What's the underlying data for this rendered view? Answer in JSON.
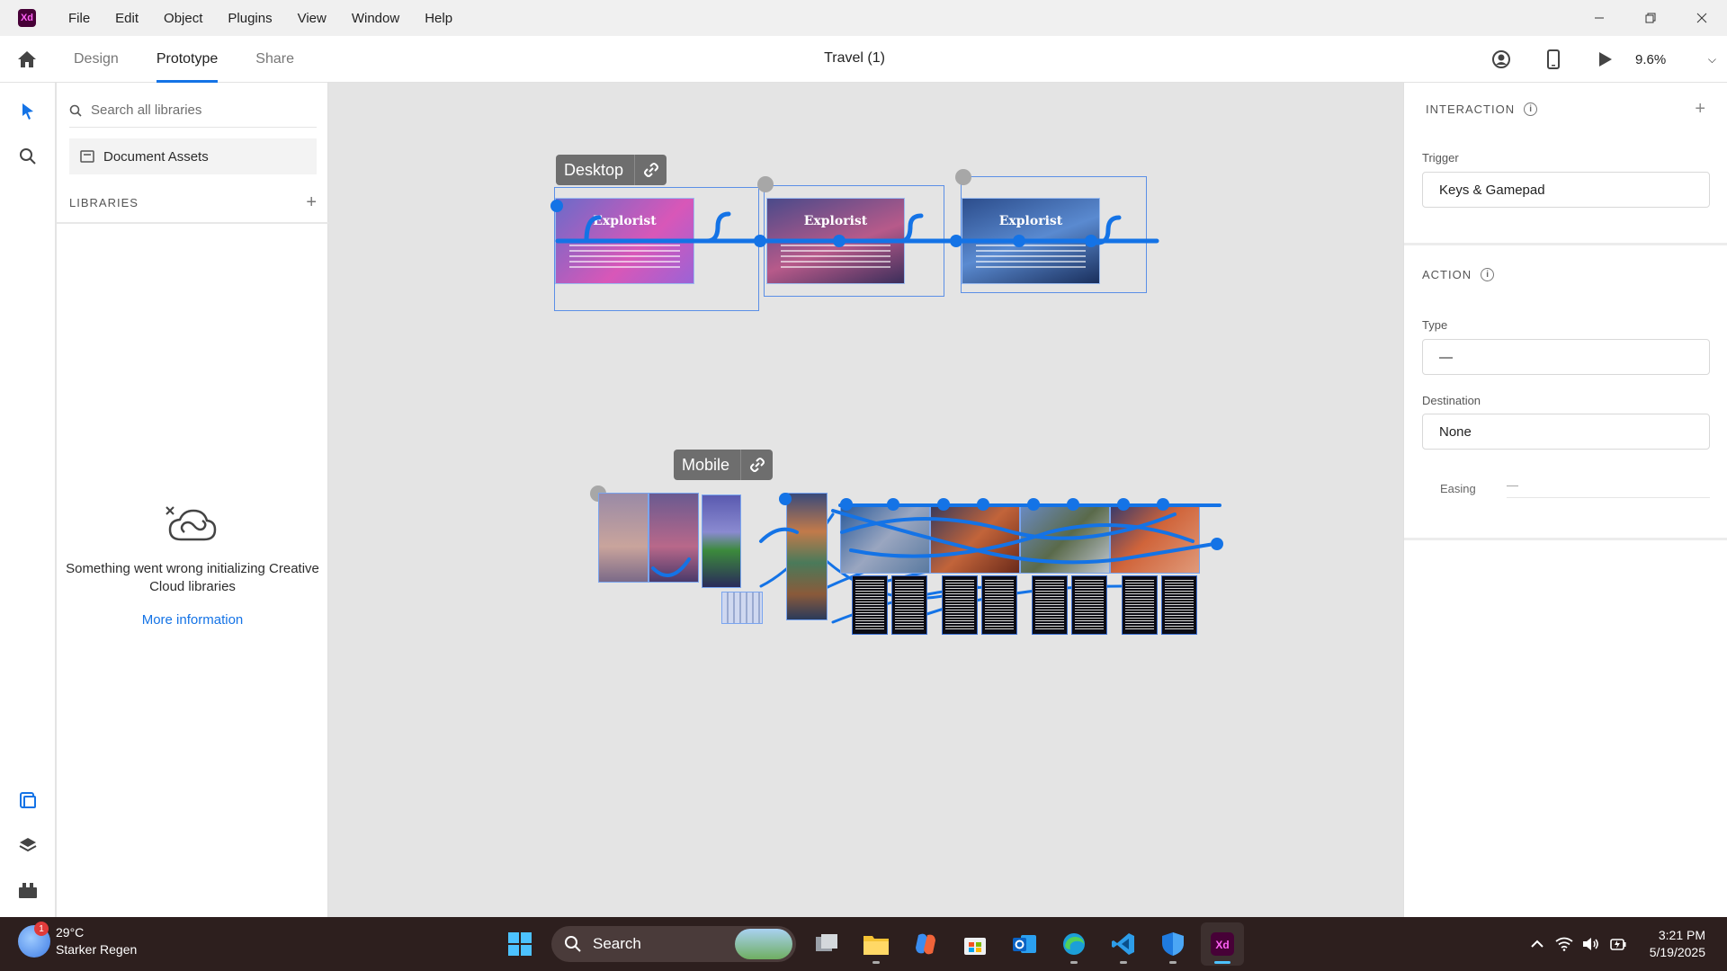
{
  "app": {
    "logo_text": "Xd"
  },
  "menu": [
    "File",
    "Edit",
    "Object",
    "Plugins",
    "View",
    "Window",
    "Help"
  ],
  "toolbar": {
    "tabs": [
      "Design",
      "Prototype",
      "Share"
    ],
    "active_tab": "Prototype",
    "document_title": "Travel (1)",
    "zoom": "9.6%"
  },
  "libraries": {
    "search_placeholder": "Search all libraries",
    "document_assets": "Document Assets",
    "section_label": "LIBRARIES",
    "error_message": "Something went wrong initializing Creative Cloud libraries",
    "more_info": "More information"
  },
  "inspector": {
    "interaction_header": "INTERACTION",
    "trigger_label": "Trigger",
    "trigger_value": "Keys & Gamepad",
    "action_header": "ACTION",
    "type_label": "Type",
    "type_value": "—",
    "destination_label": "Destination",
    "destination_value": "None",
    "easing_label": "Easing",
    "easing_value": "—"
  },
  "canvas": {
    "desktop_label": "Desktop",
    "mobile_label": "Mobile",
    "artboard_title": "Explorist"
  },
  "taskbar": {
    "weather_temp": "29°C",
    "weather_desc": "Starker Regen",
    "weather_badge": "1",
    "search_label": "Search",
    "time": "3:21 PM",
    "date": "5/19/2025"
  },
  "colors": {
    "accent": "#1473e6",
    "xd_brand": "#470137",
    "taskbar_bg": "#2d1f1e"
  }
}
